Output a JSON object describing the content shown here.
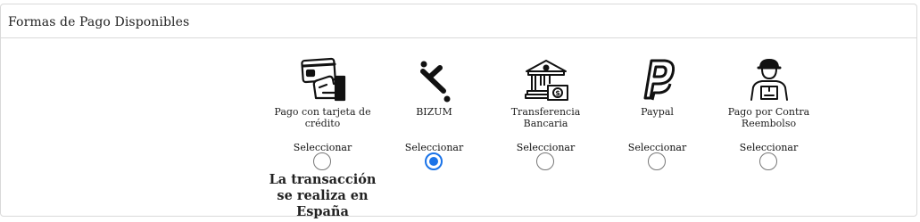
{
  "header": {
    "title": "Formas de Pago Disponibles"
  },
  "payment_methods": [
    {
      "icon": "credit-card-hand-icon",
      "label": "Pago con tarjeta de crédito",
      "select_label": "Seleccionar",
      "selected": false
    },
    {
      "icon": "bizum-logo-icon",
      "label": "BIZUM",
      "select_label": "Seleccionar",
      "selected": true
    },
    {
      "icon": "bank-transfer-icon",
      "label": "Transferencia Bancaria",
      "select_label": "Seleccionar",
      "selected": false
    },
    {
      "icon": "paypal-logo-icon",
      "label": "Paypal",
      "select_label": "Seleccionar",
      "selected": false
    },
    {
      "icon": "delivery-person-icon",
      "label": "Pago por Contra Reembolso",
      "select_label": "Seleccionar",
      "selected": false
    }
  ],
  "note": "La transacción se realiza en España",
  "colors": {
    "accent": "#1a73e8",
    "border": "#d9d9d9"
  }
}
